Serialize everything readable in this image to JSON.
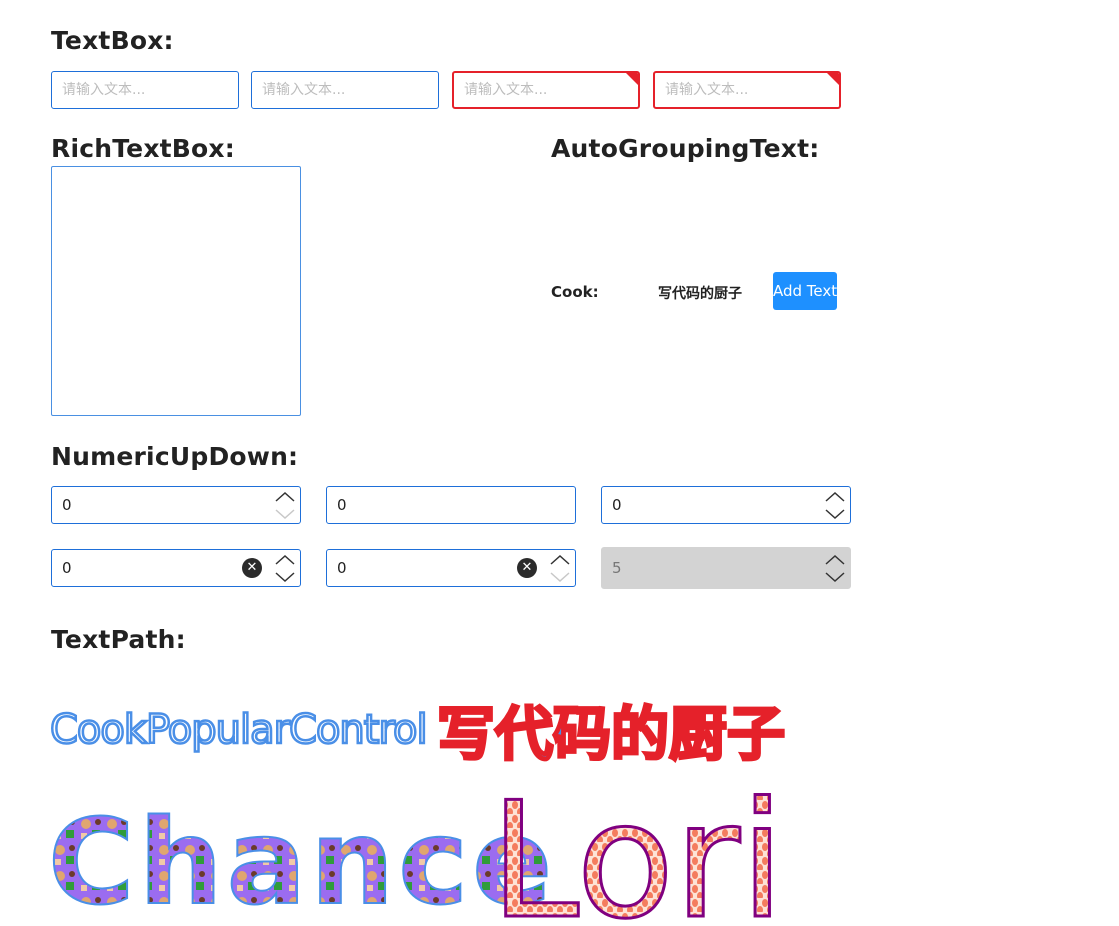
{
  "sections": {
    "textbox": "TextBox:",
    "richtextbox": "RichTextBox:",
    "autogrouping": "AutoGroupingText:",
    "numeric": "NumericUpDown:",
    "textpath": "TextPath:"
  },
  "textboxes": [
    {
      "placeholder": "请输入文本...",
      "state": "normal"
    },
    {
      "placeholder": "请输入文本...",
      "state": "normal"
    },
    {
      "placeholder": "请输入文本...",
      "state": "error"
    },
    {
      "placeholder": "请输入文本...",
      "state": "error"
    }
  ],
  "autogroup": {
    "label": "Cook:",
    "value": "写代码的厨子",
    "button": "Add Text"
  },
  "numeric": [
    {
      "value": "0"
    },
    {
      "value": "0"
    },
    {
      "value": "0"
    },
    {
      "value": "0"
    },
    {
      "value": "0"
    },
    {
      "value": "5"
    }
  ],
  "textpath": {
    "line1_a": "CookPopularControl",
    "line1_b": "写代码的厨子",
    "line2_a": "Chance",
    "line2_b": "Lori"
  },
  "colors": {
    "accent": "#1e6fd9",
    "error": "#e5212a",
    "button": "#1e90ff",
    "disabled": "#d3d3d3",
    "textpath_blue": "#4a8fe7",
    "textpath_red": "#e5212a",
    "chance_fill": "#9b6cf0",
    "lori_fill": "#f59a83",
    "lori_stroke": "#800080"
  }
}
